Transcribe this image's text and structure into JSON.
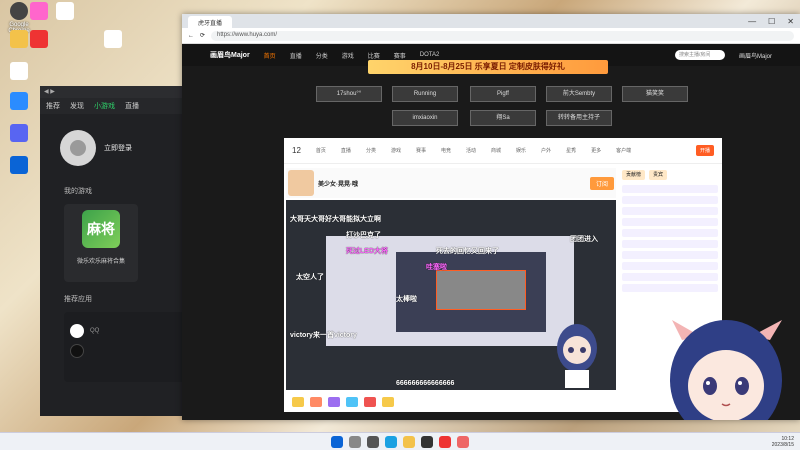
{
  "desktop": {
    "icons": [
      "Google Chrome",
      "Microsoft Edge",
      "此电脑",
      "回收站",
      "游戏",
      "文档",
      "腾讯QQ",
      "Steam",
      "Discord",
      "Outlook"
    ]
  },
  "left_app": {
    "nav": [
      "推荐",
      "发现",
      "小游戏",
      "直播"
    ],
    "login_label": "立即登录",
    "my_games_title": "我的游戏",
    "game_tile": "麻将",
    "game_name": "微乐欢乐麻将合集",
    "recommend_title": "推荐应用"
  },
  "browser": {
    "tab_title": "虎牙直播",
    "url": "https://www.huya.com/",
    "site_nav": [
      "首页",
      "直播",
      "分类",
      "游戏",
      "比赛",
      "赛事",
      "DOTA2"
    ],
    "search_placeholder": "搜索主播/房间",
    "user_name": "画眉鸟Major",
    "site_logo": "画眉鸟Major",
    "banner_text": "8月10日-8月25日 乐享夏日 定制皮肤得好礼",
    "rooms": [
      "17shou°°",
      "Running",
      "Pigff",
      "前大Sembty",
      "猫笑笑",
      "imxiaoxin",
      "翔Sa",
      "转转备用主持子"
    ]
  },
  "stream": {
    "toolbar_count": "12",
    "toolbar_labels": [
      "首页",
      "直播",
      "分类",
      "游戏",
      "赛事",
      "电竞",
      "活动",
      "商城",
      "娱乐",
      "户外",
      "星秀",
      "更多",
      "客户端"
    ],
    "open_button": "开播",
    "streamer_title": "美少女·晃晃·哦",
    "follow_label": "订阅",
    "danmaku": [
      {
        "text": "大哥天大哥好大哥能拟大立啊",
        "color": "#ffffff"
      },
      {
        "text": "打沙巴克了",
        "color": "#ffffff"
      },
      {
        "text": "死过LED大将",
        "color": "#ff66ff"
      },
      {
        "text": "太空人了",
        "color": "#ffffff"
      },
      {
        "text": "死去的回忆又回来了",
        "color": "#ffffff"
      },
      {
        "text": "团团进入",
        "color": "#ffffff"
      },
      {
        "text": "太棒啦",
        "color": "#ffffff"
      },
      {
        "text": "victory来一首victory",
        "color": "#ffffff"
      },
      {
        "text": "666666666666666",
        "color": "#ffffff"
      },
      {
        "text": "哇塞啦",
        "color": "#ff66ff"
      }
    ],
    "sidebar_tabs": [
      "贡献榜",
      "贵宾"
    ]
  },
  "taskbar": {
    "time": "10:12",
    "date": "2023/8/15"
  }
}
